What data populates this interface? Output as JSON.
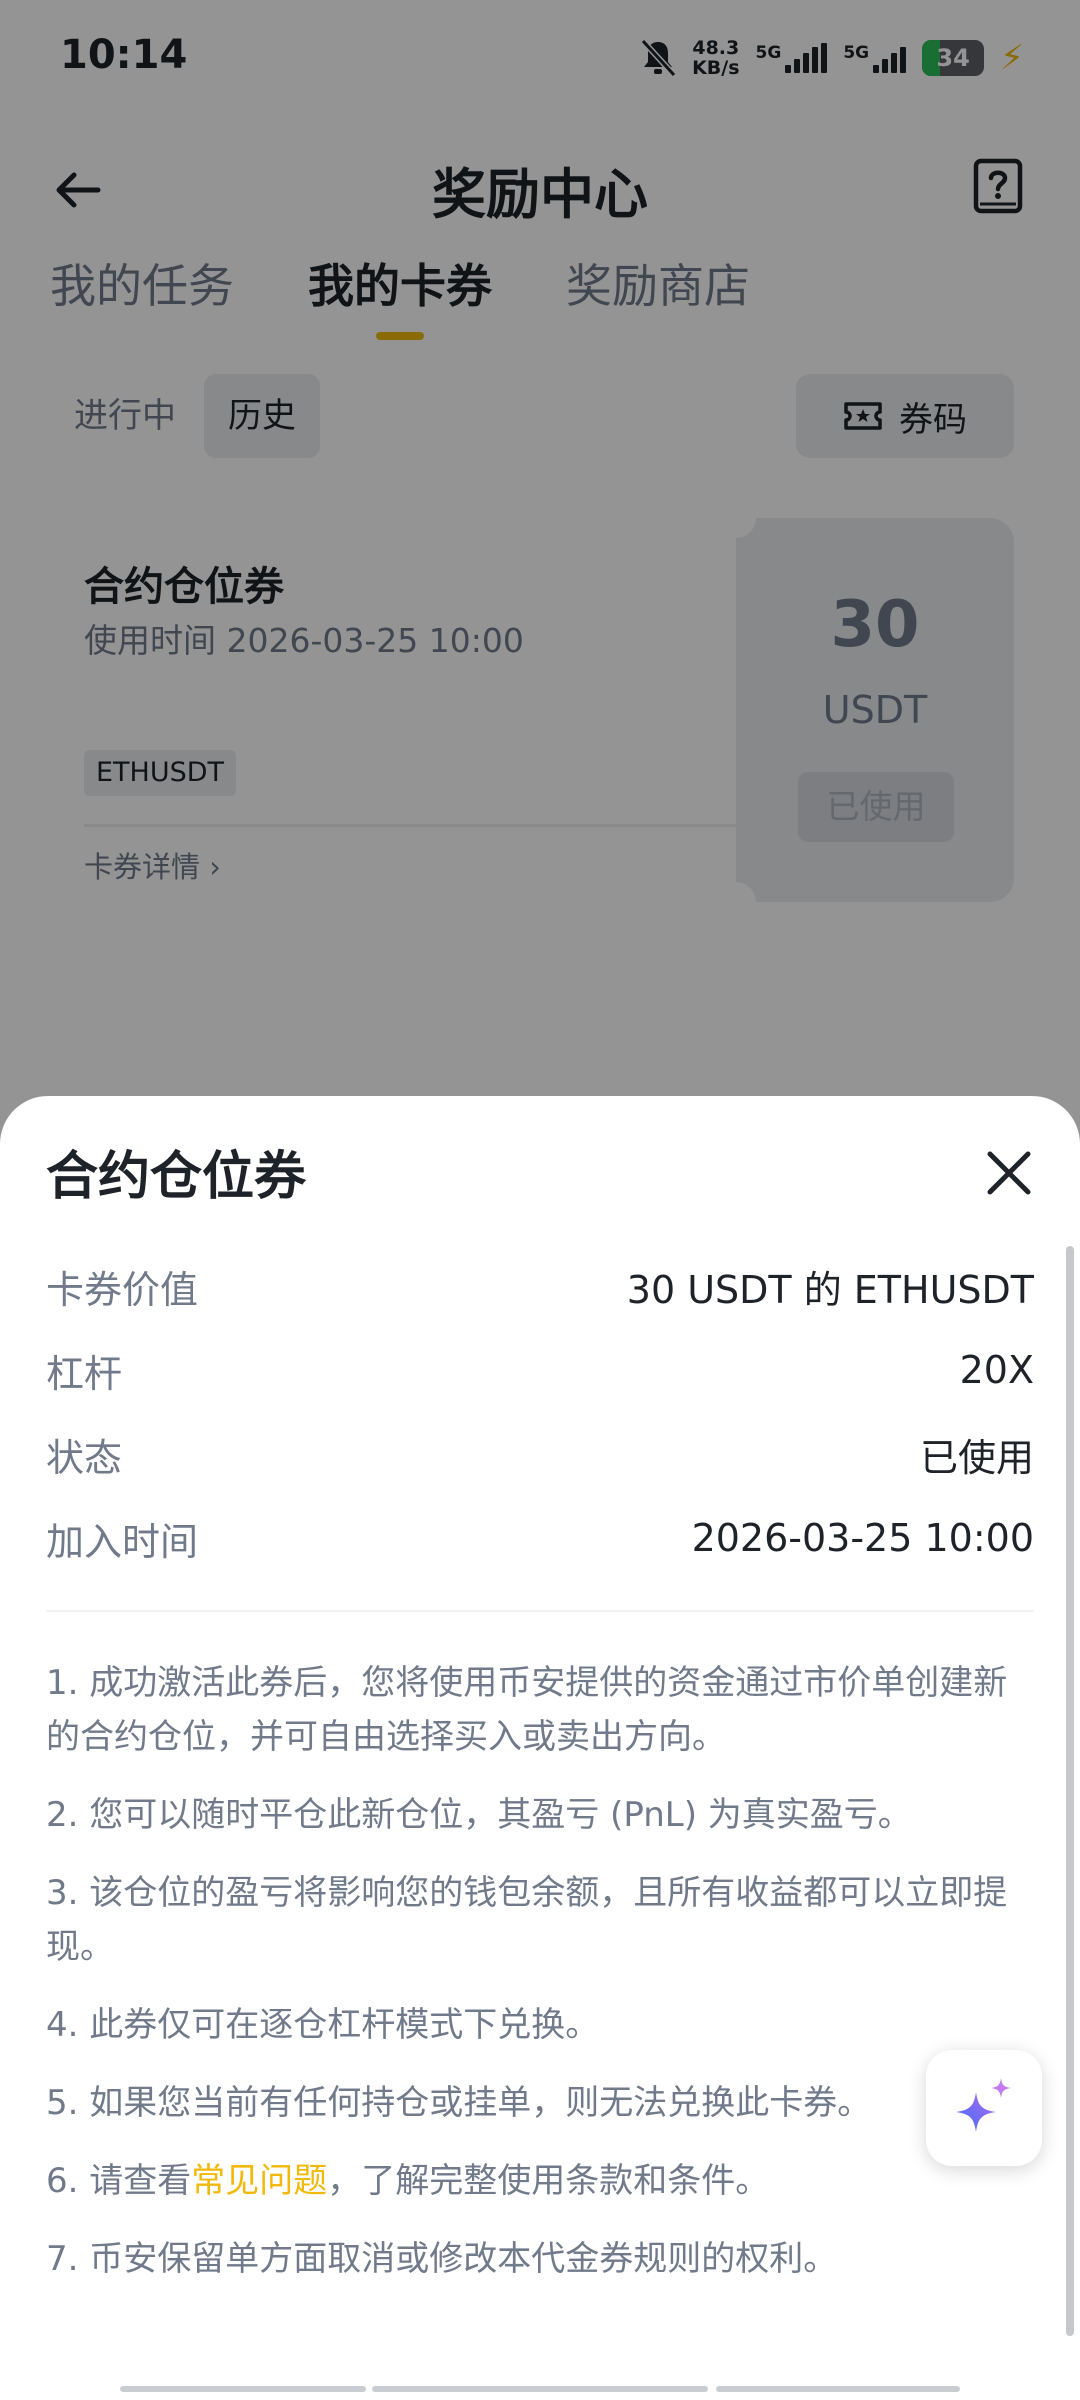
{
  "status_bar": {
    "time": "10:14",
    "net_speed_value": "48.3",
    "net_speed_unit": "KB/s",
    "sim1_label": "5G",
    "sim2_label": "5G",
    "battery": "34"
  },
  "header": {
    "title": "奖励中心"
  },
  "tabs": [
    {
      "label": "我的任务",
      "active": false
    },
    {
      "label": "我的卡券",
      "active": true
    },
    {
      "label": "奖励商店",
      "active": false
    }
  ],
  "filter": {
    "in_progress": "进行中",
    "history": "历史",
    "coupon_code": "券码"
  },
  "coupon_card": {
    "name": "合约仓位券",
    "usage_time": "使用时间 2026-03-25 10:00",
    "symbol": "ETHUSDT",
    "details_link": "卡券详情",
    "amount": "30",
    "unit": "USDT",
    "status": "已使用"
  },
  "sheet": {
    "title": "合约仓位券",
    "rows": [
      {
        "key": "卡券价值",
        "value": "30 USDT 的 ETHUSDT"
      },
      {
        "key": "杠杆",
        "value": "20X"
      },
      {
        "key": "状态",
        "value": "已使用"
      },
      {
        "key": "加入时间",
        "value": "2026-03-25 10:00"
      }
    ],
    "terms": [
      "1. 成功激活此券后，您将使用币安提供的资金通过市价单创建新的合约仓位，并可自由选择买入或卖出方向。",
      "2. 您可以随时平仓此新仓位，其盈亏 (PnL) 为真实盈亏。",
      "3. 该仓位的盈亏将影响您的钱包余额，且所有收益都可以立即提现。",
      "4. 此券仅可在逐仓杠杆模式下兑换。",
      "5. 如果您当前有任何持仓或挂单，则无法兑换此卡券。"
    ],
    "term6": {
      "before": "6. 请查看",
      "link": "常见问题",
      "after": "，了解完整使用条款和条件。"
    },
    "term7": "7. 币安保留单方面取消或修改本代金券规则的权利。"
  },
  "colors": {
    "accent": "#f0b90b",
    "text_primary": "#1e2329",
    "text_secondary": "#707a8a",
    "scrim": "rgba(0,0,0,0.42)"
  },
  "icons": [
    "back-arrow-icon",
    "help-book-icon",
    "ticket-icon",
    "chevron-right-icon",
    "close-icon",
    "ai-sparkle-icon",
    "bell-muted-icon",
    "bolt-icon"
  ]
}
